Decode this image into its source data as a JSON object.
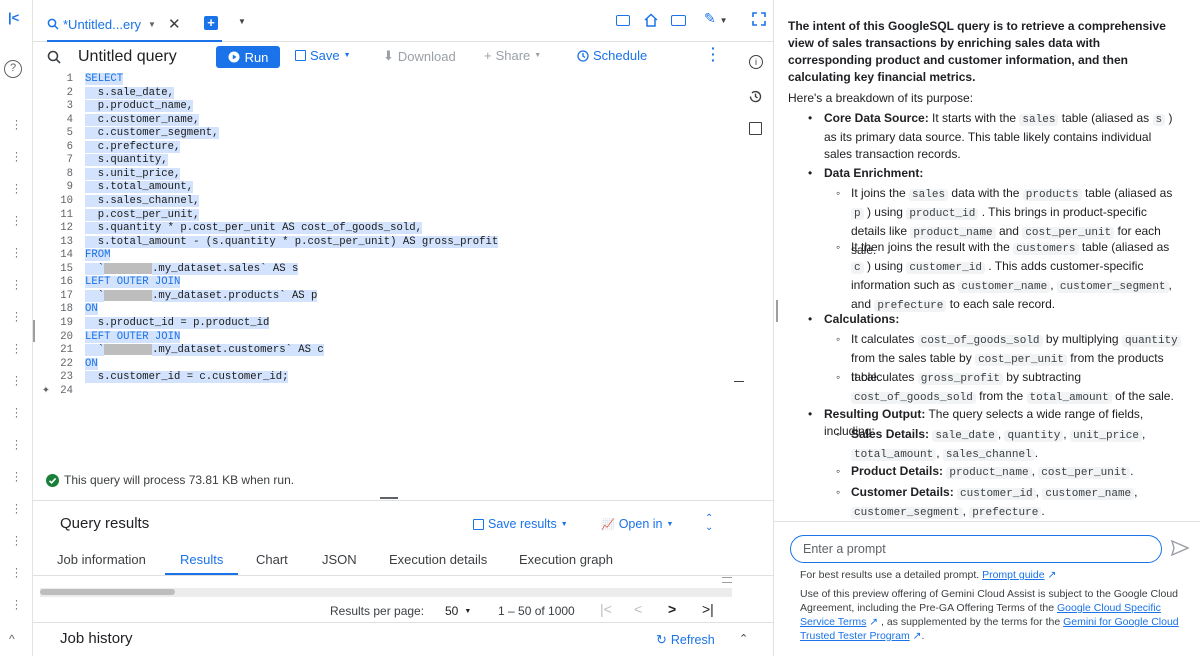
{
  "tab": {
    "title": "*Untitled...ery"
  },
  "query": {
    "title": "Untitled query",
    "run_label": "Run",
    "save_label": "Save",
    "download_label": "Download",
    "share_label": "Share",
    "schedule_label": "Schedule"
  },
  "editor": {
    "line_numbers": [
      "1",
      "2",
      "3",
      "4",
      "5",
      "6",
      "7",
      "8",
      "9",
      "10",
      "11",
      "12",
      "13",
      "14",
      "15",
      "16",
      "17",
      "18",
      "19",
      "20",
      "21",
      "22",
      "23",
      "24"
    ],
    "lines": [
      "SELECT",
      "  s.sale_date,",
      "  p.product_name,",
      "  c.customer_name,",
      "  c.customer_segment,",
      "  c.prefecture,",
      "  s.quantity,",
      "  s.unit_price,",
      "  s.total_amount,",
      "  s.sales_channel,",
      "  p.cost_per_unit,",
      "  s.quantity * p.cost_per_unit AS cost_of_goods_sold,",
      "  s.total_amount - (s.quantity * p.cost_per_unit) AS gross_profit",
      "FROM",
      "  `",
      ".my_dataset.sales` AS s",
      "LEFT OUTER JOIN",
      ".my_dataset.products` AS p",
      "ON",
      "  s.product_id = p.product_id",
      "LEFT OUTER JOIN",
      ".my_dataset.customers` AS c",
      "ON",
      "  s.customer_id = c.customer_id;"
    ]
  },
  "validation": {
    "text": "This query will process 73.81 KB when run."
  },
  "results": {
    "title": "Query results",
    "save_results_label": "Save results",
    "open_in_label": "Open in",
    "tabs": [
      "Job information",
      "Results",
      "Chart",
      "JSON",
      "Execution details",
      "Execution graph"
    ],
    "per_page_label": "Results per page:",
    "per_page_value": "50",
    "range": "1 – 50 of 1000"
  },
  "job_history": {
    "title": "Job history",
    "refresh_label": "Refresh"
  },
  "gemini": {
    "intro": "The intent of this GoogleSQL query is to retrieve a comprehensive view of sales transactions by enriching sales data with corresponding product and customer information, and then calculating key financial metrics.",
    "breakdown": "Here's a breakdown of its purpose:",
    "core_title": "Core Data Source:",
    "core_1": "It starts with the",
    "core_sales": "sales",
    "core_2": "table (aliased as",
    "core_s": "s",
    "core_3": ") as its primary data source. This table likely contains individual sales transaction records.",
    "enrich_title": "Data Enrichment:",
    "enrich_a1": "It joins the",
    "enrich_a_sales": "sales",
    "enrich_a2": "data with the",
    "enrich_a_products": "products",
    "enrich_a3": "table (aliased as",
    "enrich_a_p": "p",
    "enrich_a4": ")",
    "enrich_a5": "using",
    "enrich_a_pid": "product_id",
    "enrich_a6": ". This brings in product-specific details like",
    "enrich_a_pname": "product_name",
    "enrich_a7": "and",
    "enrich_a_cpu": "cost_per_unit",
    "enrich_a8": "for each sale.",
    "enrich_b1": "It then joins the result with the",
    "enrich_b_customers": "customers",
    "enrich_b2": "table (aliased as",
    "enrich_b_c": "c",
    "enrich_b3": ") using",
    "enrich_b_cid": "customer_id",
    "enrich_b4": ". This adds customer-specific information such as",
    "enrich_b_cname": "customer_name",
    "enrich_b_cseg": "customer_segment",
    "enrich_b5": ", and",
    "enrich_b_pref": "prefecture",
    "enrich_b6": "to each sale record.",
    "calc_title": "Calculations:",
    "calc_a1": "It calculates",
    "calc_a_cogs": "cost_of_goods_sold",
    "calc_a2": "by multiplying",
    "calc_a_qty": "quantity",
    "calc_a3": "from the sales table by",
    "calc_a_cpu": "cost_per_unit",
    "calc_a4": "from the products table.",
    "calc_b1": "It calculates",
    "calc_b_gp": "gross_profit",
    "calc_b2": "by subtracting",
    "calc_b_cogs": "cost_of_goods_sold",
    "calc_b3": "from the",
    "calc_b_total": "total_amount",
    "calc_b4": "of the sale.",
    "out_title": "Resulting Output:",
    "out_text": "The query selects a wide range of fields, including:",
    "sales_details": "Sales Details:",
    "sd_1": "sale_date",
    "sd_2": "quantity",
    "sd_3": "unit_price",
    "sd_4": "total_amount",
    "sd_5": "sales_channel",
    "product_details": "Product Details:",
    "pd_1": "product_name",
    "pd_2": "cost_per_unit",
    "customer_details": "Customer Details:",
    "cd_1": "customer_id",
    "cd_2": "customer_name",
    "cd_3": "customer_segment",
    "cd_4": "prefecture",
    "prompt_placeholder": "Enter a prompt",
    "tip": "For best results use a detailed prompt.",
    "tip_link": "Prompt guide",
    "terms_1": "Use of this preview offering of Gemini Cloud Assist is subject to the Google Cloud Agreement, including the Pre-GA Offering Terms of the",
    "terms_link1": "Google Cloud Specific Service Terms",
    "terms_2": ", as supplemented by the terms for the",
    "terms_link2": "Gemini for Google Cloud Trusted Tester Program"
  },
  "colors": {
    "accent": "#1a73e8",
    "selection": "#d3e3fd",
    "success": "#188038"
  }
}
